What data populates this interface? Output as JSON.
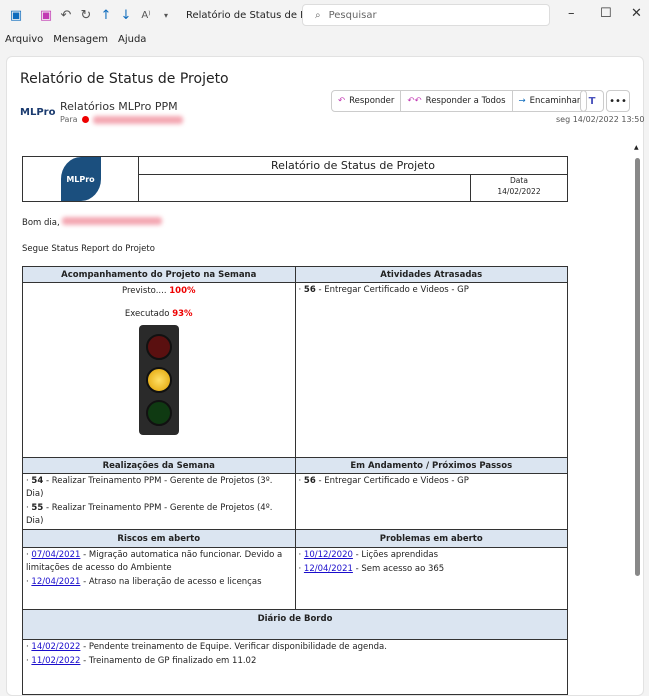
{
  "window": {
    "title": "Relatório de Status de Projeto  -  Mensagem (HTML)",
    "search_placeholder": "Pesquisar"
  },
  "menu": [
    "Arquivo",
    "Mensagem",
    "Ajuda"
  ],
  "message": {
    "subject": "Relatório de Status de Projeto",
    "sender": "Relatórios MLPro PPM",
    "to_label": "Para",
    "date": "seg 14/02/2022 13:50",
    "logo_text": "MLPro",
    "actions": {
      "reply": "Responder",
      "reply_all": "Responder a Todos",
      "forward": "Encaminhar"
    }
  },
  "report": {
    "title": "Relatório de Status de Projeto",
    "date_label": "Data",
    "date": "14/02/2022",
    "logo_text": "MLPro",
    "greeting": "Bom dia,",
    "intro": "Segue Status Report do Projeto",
    "sections": {
      "acompanhamento": {
        "title": "Acompanhamento do Projeto na Semana",
        "previsto_label": "Previsto....",
        "previsto": "100%",
        "executado_label": "Executado",
        "executado": "93%",
        "traffic_light": "yellow"
      },
      "atrasadas": {
        "title": "Atividades Atrasadas",
        "items": [
          {
            "id": "56",
            "text": " - Entregar Certificado e Videos - GP"
          }
        ]
      },
      "realizacoes": {
        "title": "Realizações da Semana",
        "items": [
          {
            "id": "54",
            "text": " - Realizar Treinamento PPM - Gerente de Projetos (3º. Dia)"
          },
          {
            "id": "55",
            "text": " - Realizar Treinamento PPM - Gerente de Projetos (4º. Dia)"
          }
        ]
      },
      "andamento": {
        "title": "Em Andamento / Próximos Passos",
        "items": [
          {
            "id": "56",
            "text": " - Entregar Certificado e Videos - GP"
          }
        ]
      },
      "riscos": {
        "title": "Riscos em aberto",
        "items": [
          {
            "date": "07/04/2021",
            "text": " - Migração automatica não funcionar. Devido a limitações de acesso do Ambiente"
          },
          {
            "date": "12/04/2021",
            "text": " - Atraso na liberação de acesso e licenças"
          }
        ]
      },
      "problemas": {
        "title": "Problemas em aberto",
        "items": [
          {
            "date": "10/12/2020",
            "text": " - Lições aprendidas"
          },
          {
            "date": "12/04/2021",
            "text": " - Sem acesso ao 365"
          }
        ]
      },
      "diario": {
        "title": "Diário de Bordo",
        "items": [
          {
            "date": "14/02/2022",
            "text": " - Pendente treinamento de Equipe. Verificar disponibilidade de agenda."
          },
          {
            "date": "11/02/2022",
            "text": " - Treinamento de GP finalizado em 11.02"
          }
        ]
      }
    }
  },
  "colors": {
    "header_bg": "#dbe5f1",
    "red": "#e00000",
    "link": "#1a0dcc",
    "accent": "#0f6cbd"
  }
}
